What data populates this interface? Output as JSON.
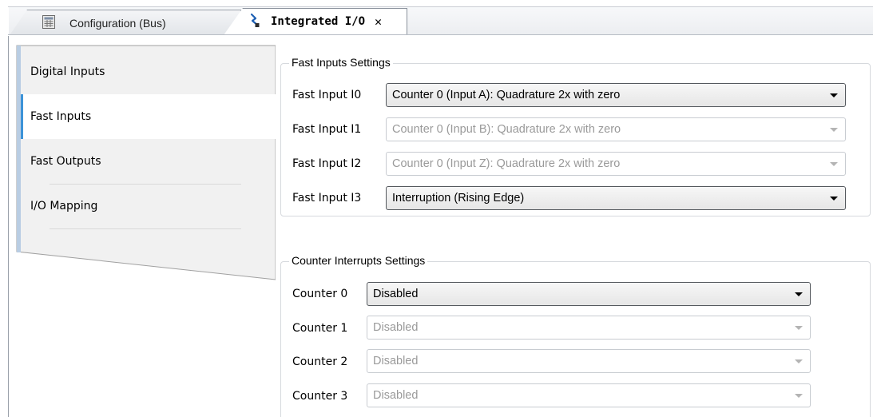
{
  "tabs": [
    {
      "label": "Configuration (Bus)",
      "icon": "table-icon",
      "active": false
    },
    {
      "label": "Integrated I/O",
      "icon": "io-connector-icon",
      "active": true,
      "close": "✕"
    }
  ],
  "nav": {
    "items": [
      {
        "label": "Digital Inputs",
        "selected": false
      },
      {
        "label": "Fast Inputs",
        "selected": true
      },
      {
        "label": "Fast Outputs",
        "selected": false
      },
      {
        "label": "I/O Mapping",
        "selected": false
      }
    ]
  },
  "fast_inputs": {
    "title": "Fast Inputs Settings",
    "rows": [
      {
        "label": "Fast Input I0",
        "value": "Counter 0 (Input A): Quadrature 2x with zero",
        "enabled": true
      },
      {
        "label": "Fast Input I1",
        "value": "Counter 0 (Input B): Quadrature 2x with zero",
        "enabled": false
      },
      {
        "label": "Fast Input I2",
        "value": "Counter 0 (Input Z): Quadrature 2x with zero",
        "enabled": false
      },
      {
        "label": "Fast Input I3",
        "value": "Interruption (Rising Edge)",
        "enabled": true
      }
    ]
  },
  "counter_interrupts": {
    "title": "Counter Interrupts Settings",
    "rows": [
      {
        "label": "Counter 0",
        "value": "Disabled",
        "enabled": true
      },
      {
        "label": "Counter 1",
        "value": "Disabled",
        "enabled": false
      },
      {
        "label": "Counter 2",
        "value": "Disabled",
        "enabled": false
      },
      {
        "label": "Counter 3",
        "value": "Disabled",
        "enabled": false
      }
    ]
  },
  "colors": {
    "selection_bar": "#3c93d8",
    "nav_background": "#f1f1f1",
    "disabled_text": "#9a9a9a"
  }
}
